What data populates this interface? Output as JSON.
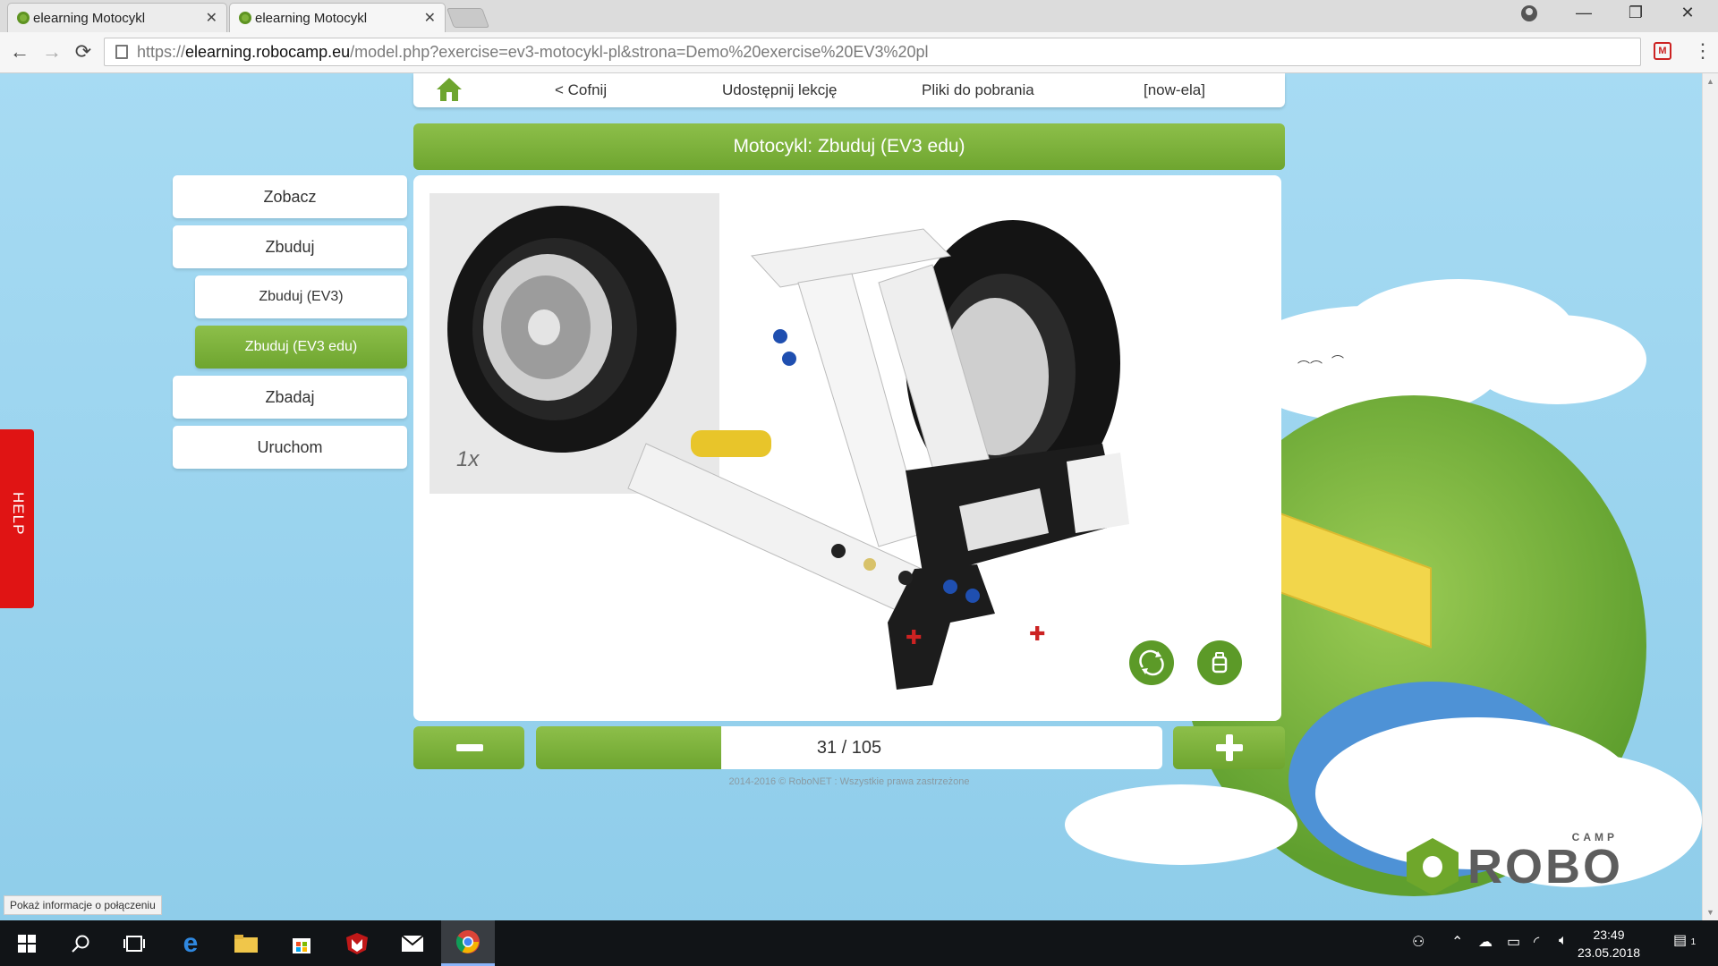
{
  "browser": {
    "tabs": [
      {
        "title": "elearning Motocykl"
      },
      {
        "title": "elearning Motocykl"
      }
    ],
    "url_scheme": "https://",
    "url_host": "elearning.robocamp.eu",
    "url_path": "/model.php?exercise=ev3-motocykl-pl&strona=Demo%20exercise%20EV3%20pl",
    "window_controls": {
      "minimize": "—",
      "restore": "❐",
      "close": "✕"
    },
    "nav": {
      "back": "←",
      "forward": "→",
      "reload": "⟳"
    },
    "extension_label": "M",
    "menu": "⋮"
  },
  "topnav": {
    "home_icon": "home-icon",
    "back_label": "< Cofnij",
    "share_label": "Udostępnij lekcję",
    "downloads_label": "Pliki do pobrania",
    "user_label": "[now-ela]"
  },
  "title": "Motocykl: Zbuduj (EV3 edu)",
  "side_menu": {
    "items": [
      {
        "label": "Zobacz"
      },
      {
        "label": "Zbuduj"
      },
      {
        "label": "Zbuduj (EV3)"
      },
      {
        "label": "Zbuduj (EV3 edu)"
      },
      {
        "label": "Zbadaj"
      },
      {
        "label": "Uruchom"
      }
    ]
  },
  "viewer": {
    "parts_count": "1x",
    "rotate_icon": "rotate-icon",
    "parts_icon": "parts-icon"
  },
  "progress": {
    "current": 31,
    "total": 105,
    "label": "31 / 105"
  },
  "copyright": "2014-2016 © RoboNET : Wszystkie prawa zastrzeżone",
  "help_label": "HELP",
  "status_tip": "Pokaż informacje o połączeniu",
  "logo": {
    "brand": "ROBO",
    "sub": "CAMP"
  },
  "taskbar": {
    "time": "23:49",
    "date": "23.05.2018",
    "notification_count": "1"
  },
  "colors": {
    "accent": "#6ea52f",
    "help": "#e01414"
  }
}
